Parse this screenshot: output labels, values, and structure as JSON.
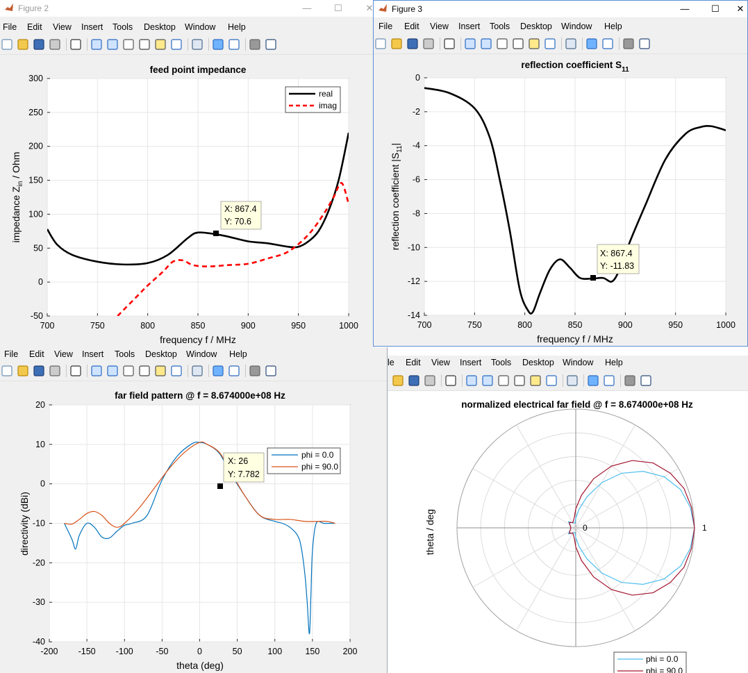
{
  "fig2": {
    "title": "Figure 2",
    "plot_title": "feed point impedance",
    "xlabel": "frequency f / MHz",
    "ylabel_main": "impedance Z",
    "ylabel_sub": "in",
    "ylabel_tail": " / Ohm",
    "xticks": [
      "700",
      "750",
      "800",
      "850",
      "900",
      "950",
      "1000"
    ],
    "yticks": [
      "300",
      "250",
      "200",
      "150",
      "100",
      "50",
      "0",
      "-50"
    ],
    "legend": [
      "real",
      "imag"
    ],
    "datatip": {
      "x": "X: 867.4",
      "y": "Y: 70.6"
    }
  },
  "fig3": {
    "title": "Figure 3",
    "plot_title_main": "reflection coefficient S",
    "plot_title_sub": "11",
    "xlabel": "frequency f / MHz",
    "ylabel_main": "reflection coefficient |S",
    "ylabel_sub": "11",
    "ylabel_tail": "|",
    "xticks": [
      "700",
      "750",
      "800",
      "850",
      "900",
      "950",
      "1000"
    ],
    "yticks": [
      "0",
      "-2",
      "-4",
      "-6",
      "-8",
      "-10",
      "-12",
      "-14"
    ],
    "datatip": {
      "x": "X: 867.4",
      "y": "Y: -11.83"
    }
  },
  "fig4": {
    "plot_title": "far field pattern @ f = 8.674000e+08 Hz",
    "xlabel": "theta (deg)",
    "ylabel": "directivity (dBi)",
    "xticks": [
      "-200",
      "-150",
      "-100",
      "-50",
      "0",
      "50",
      "100",
      "150",
      "200"
    ],
    "yticks": [
      "20",
      "10",
      "0",
      "-10",
      "-20",
      "-30",
      "-40"
    ],
    "legend": [
      "phi = 0.0",
      "phi = 90.0"
    ],
    "datatip": {
      "x": "X: 26",
      "y": "Y: 7.782"
    }
  },
  "fig5": {
    "plot_title": "normalized electrical far field @ f = 8.674000e+08 Hz",
    "ylabel": "theta / deg",
    "r0": "0",
    "r1": "1",
    "legend": [
      "phi = 0.0",
      "phi = 90.0"
    ]
  },
  "menu": [
    "File",
    "Edit",
    "View",
    "Insert",
    "Tools",
    "Desktop",
    "Window",
    "Help"
  ],
  "menu_partial_e": "le",
  "colors": {
    "black": "#000000",
    "red": "#ff0000",
    "blue": "#0072bd",
    "orange": "#d95319",
    "cyan": "#4dbeee",
    "maroon": "#a2142f"
  },
  "chart_data": [
    {
      "type": "line",
      "title": "feed point impedance",
      "xlabel": "frequency f / MHz",
      "ylabel": "impedance Z_in / Ohm",
      "xlim": [
        700,
        1000
      ],
      "ylim": [
        -50,
        300
      ],
      "grid": true,
      "legend_position": "top-right",
      "series": [
        {
          "name": "real",
          "x": [
            700,
            710,
            725,
            750,
            775,
            800,
            820,
            840,
            850,
            867.4,
            880,
            900,
            920,
            940,
            950,
            960,
            970,
            980,
            990,
            1000
          ],
          "y": [
            78,
            55,
            40,
            30,
            26,
            28,
            40,
            65,
            73,
            70.6,
            67,
            60,
            57,
            52,
            52,
            60,
            75,
            105,
            150,
            220
          ]
        },
        {
          "name": "imag",
          "x": [
            770,
            790,
            800,
            815,
            825,
            835,
            845,
            860,
            880,
            900,
            920,
            940,
            960,
            975,
            985,
            993,
            1000
          ],
          "y": [
            -50,
            -20,
            -5,
            15,
            30,
            32,
            25,
            23,
            25,
            27,
            35,
            45,
            70,
            100,
            125,
            146,
            115
          ]
        }
      ]
    },
    {
      "type": "line",
      "title": "reflection coefficient S11",
      "xlabel": "frequency f / MHz",
      "ylabel": "reflection coefficient |S11|",
      "xlim": [
        700,
        1000
      ],
      "ylim": [
        -14,
        0
      ],
      "grid": true,
      "series": [
        {
          "x": [
            700,
            725,
            750,
            765,
            775,
            785,
            795,
            803,
            808,
            815,
            825,
            835,
            845,
            855,
            867.4,
            878,
            887,
            895,
            905,
            920,
            940,
            960,
            975,
            985,
            995,
            1000
          ],
          "y": [
            -0.6,
            -0.9,
            -1.8,
            -3.5,
            -6,
            -9,
            -12.5,
            -13.7,
            -13.8,
            -12.7,
            -11.3,
            -10.7,
            -11.2,
            -11.8,
            -11.83,
            -11.8,
            -12,
            -11.2,
            -9.6,
            -7.5,
            -4.8,
            -3.3,
            -2.9,
            -2.85,
            -3,
            -3.1
          ]
        }
      ]
    },
    {
      "type": "line",
      "title": "far field pattern @ f = 8.674000e+08 Hz",
      "xlabel": "theta (deg)",
      "ylabel": "directivity (dBi)",
      "xlim": [
        -200,
        200
      ],
      "ylim": [
        -40,
        20
      ],
      "grid": true,
      "legend_position": "top-right",
      "series": [
        {
          "name": "phi = 0.0",
          "x": [
            -180,
            -170,
            -165,
            -160,
            -150,
            -140,
            -130,
            -120,
            -110,
            -100,
            -90,
            -70,
            -50,
            -30,
            -10,
            0,
            10,
            26,
            40,
            60,
            80,
            100,
            110,
            120,
            130,
            135,
            140,
            143,
            146,
            148,
            150,
            155,
            165,
            175,
            180
          ],
          "y": [
            -10,
            -14,
            -16.5,
            -13,
            -10,
            -11,
            -13.5,
            -13.7,
            -12,
            -10.5,
            -10,
            -8,
            1,
            7,
            10.2,
            10.5,
            10,
            7.782,
            3,
            -3,
            -8,
            -9.5,
            -10,
            -11,
            -13,
            -16,
            -23,
            -30,
            -38,
            -28,
            -17,
            -10,
            -10,
            -10,
            -10
          ]
        },
        {
          "name": "phi = 90.0",
          "x": [
            -180,
            -170,
            -160,
            -150,
            -140,
            -130,
            -120,
            -110,
            -100,
            -80,
            -60,
            -40,
            -20,
            0,
            10,
            26,
            40,
            60,
            80,
            100,
            120,
            140,
            160,
            170,
            180
          ],
          "y": [
            -10,
            -10.2,
            -9,
            -7.5,
            -7,
            -8,
            -10,
            -11,
            -10,
            -6,
            -1,
            4,
            8,
            10.5,
            10,
            8,
            3.5,
            -3,
            -8,
            -9,
            -9,
            -9.5,
            -9.5,
            -9.5,
            -10
          ]
        }
      ]
    },
    {
      "type": "polar",
      "title": "normalized electrical far field @ f = 8.674000e+08 Hz",
      "ylabel": "theta / deg",
      "rlim": [
        0,
        1
      ],
      "rtick_labels": [
        "0",
        "1"
      ],
      "grid": true,
      "legend_position": "bottom",
      "series": [
        {
          "name": "phi = 0.0",
          "angle_deg": [
            0,
            10,
            20,
            30,
            40,
            50,
            60,
            70,
            80,
            90,
            100,
            120,
            140,
            160,
            180
          ],
          "r": [
            1,
            0.98,
            0.94,
            0.86,
            0.74,
            0.6,
            0.44,
            0.28,
            0.16,
            0.08,
            0.04,
            0.05,
            0.08,
            0.05,
            0.04
          ]
        },
        {
          "name": "phi = 90.0",
          "angle_deg": [
            0,
            10,
            20,
            30,
            40,
            50,
            60,
            70,
            80,
            90,
            100,
            120,
            140,
            160,
            180
          ],
          "r": [
            1,
            0.99,
            0.97,
            0.92,
            0.85,
            0.74,
            0.6,
            0.44,
            0.28,
            0.16,
            0.08,
            0.05,
            0.07,
            0.05,
            0.04
          ]
        }
      ]
    }
  ]
}
